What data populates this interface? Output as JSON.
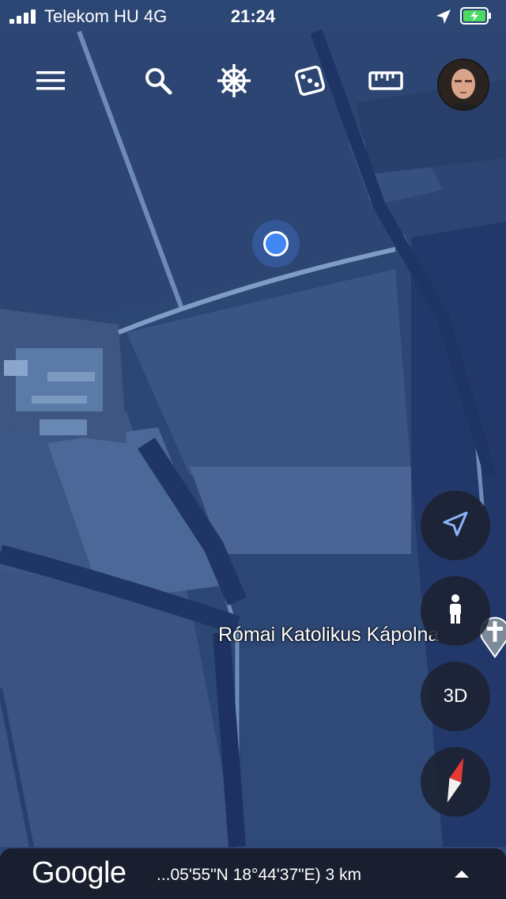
{
  "status_bar": {
    "carrier": "Telekom HU  4G",
    "time": "21:24"
  },
  "toolbar": {
    "items": [
      {
        "name": "menu-icon"
      },
      {
        "name": "search-icon"
      },
      {
        "name": "voyager-icon"
      },
      {
        "name": "dice-icon"
      },
      {
        "name": "ruler-icon"
      }
    ]
  },
  "map": {
    "place_label": "Római Katolikus Kápolna",
    "place_icon": "church-cross-icon"
  },
  "controls": {
    "my_location_icon": "navigation-arrow-icon",
    "street_view_icon": "pegman-icon",
    "view_3d_label": "3D",
    "compass_icon": "compass-icon"
  },
  "bottom_bar": {
    "logo": "Google",
    "coordinates": "...05'55\"N 18°44'37\"E) 3 km",
    "expand_icon": "chevron-up-icon"
  },
  "colors": {
    "location_dot": "#4285f4",
    "compass_needle": "#e53935"
  }
}
